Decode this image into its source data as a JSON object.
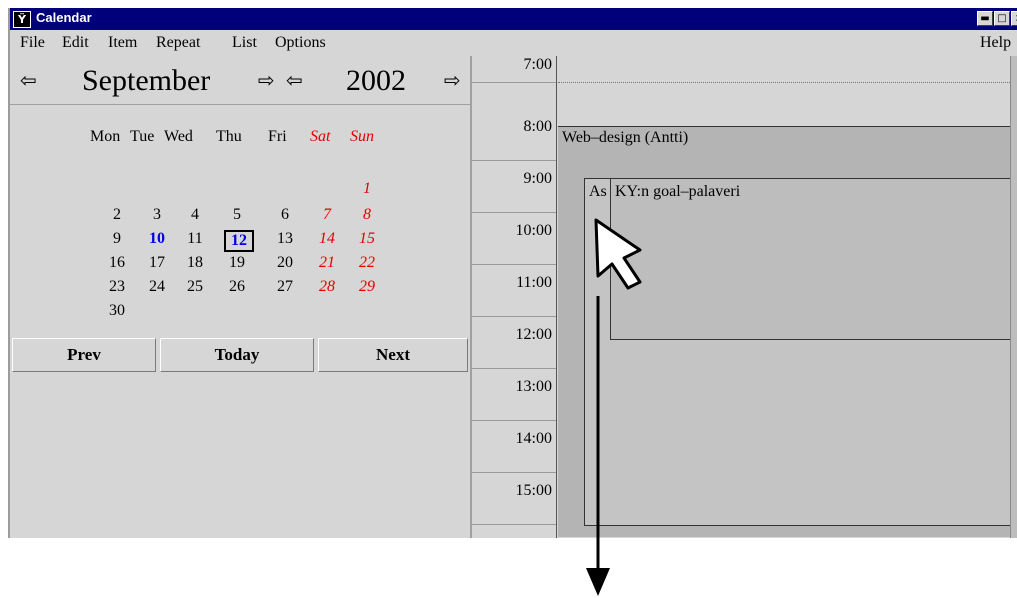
{
  "window": {
    "title": "Calendar",
    "app_icon": "calendar-app-icon",
    "controls": {
      "minimize": "▬",
      "maximize": "□",
      "close": "×"
    }
  },
  "menu": {
    "items": [
      "File",
      "Edit",
      "Item",
      "Repeat",
      "List",
      "Options"
    ],
    "help": "Help"
  },
  "calendar": {
    "month": "September",
    "year": "2002",
    "weekdays": [
      "Mon",
      "Tue",
      "Wed",
      "Thu",
      "Fri",
      "Sat",
      "Sun"
    ],
    "days": [
      {
        "d": "1",
        "col": 6,
        "row": 0
      },
      {
        "d": "2",
        "col": 0,
        "row": 1
      },
      {
        "d": "3",
        "col": 1,
        "row": 1
      },
      {
        "d": "4",
        "col": 2,
        "row": 1
      },
      {
        "d": "5",
        "col": 3,
        "row": 1
      },
      {
        "d": "6",
        "col": 4,
        "row": 1
      },
      {
        "d": "7",
        "col": 5,
        "row": 1
      },
      {
        "d": "8",
        "col": 6,
        "row": 1
      },
      {
        "d": "9",
        "col": 0,
        "row": 2
      },
      {
        "d": "10",
        "col": 1,
        "row": 2,
        "highlight": true
      },
      {
        "d": "11",
        "col": 2,
        "row": 2
      },
      {
        "d": "12",
        "col": 3,
        "row": 2,
        "today": true
      },
      {
        "d": "13",
        "col": 4,
        "row": 2
      },
      {
        "d": "14",
        "col": 5,
        "row": 2
      },
      {
        "d": "15",
        "col": 6,
        "row": 2
      },
      {
        "d": "16",
        "col": 0,
        "row": 3
      },
      {
        "d": "17",
        "col": 1,
        "row": 3
      },
      {
        "d": "18",
        "col": 2,
        "row": 3
      },
      {
        "d": "19",
        "col": 3,
        "row": 3
      },
      {
        "d": "20",
        "col": 4,
        "row": 3
      },
      {
        "d": "21",
        "col": 5,
        "row": 3
      },
      {
        "d": "22",
        "col": 6,
        "row": 3
      },
      {
        "d": "23",
        "col": 0,
        "row": 4
      },
      {
        "d": "24",
        "col": 1,
        "row": 4
      },
      {
        "d": "25",
        "col": 2,
        "row": 4
      },
      {
        "d": "26",
        "col": 3,
        "row": 4
      },
      {
        "d": "27",
        "col": 4,
        "row": 4
      },
      {
        "d": "28",
        "col": 5,
        "row": 4
      },
      {
        "d": "29",
        "col": 6,
        "row": 4
      },
      {
        "d": "30",
        "col": 0,
        "row": 5
      }
    ],
    "buttons": {
      "prev": "Prev",
      "today": "Today",
      "next": "Next"
    }
  },
  "day_view": {
    "hours": [
      "7:00",
      "8:00",
      "9:00",
      "10:00",
      "11:00",
      "12:00",
      "13:00",
      "14:00",
      "15:00"
    ],
    "events": [
      {
        "label": "Web–design (Antti)"
      },
      {
        "label": "As"
      },
      {
        "label": "KY:n goal–palaveri"
      }
    ]
  },
  "colors": {
    "titlebar": "#00007b",
    "weekend": "#e00000",
    "highlight": "#0000e0"
  }
}
